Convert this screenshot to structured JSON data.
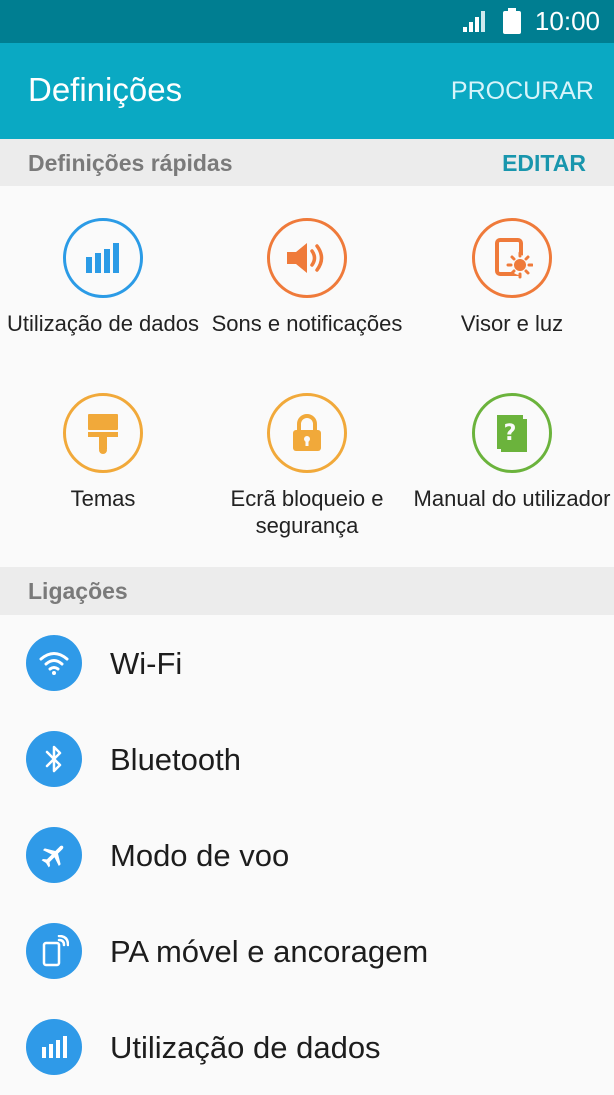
{
  "status_bar": {
    "time": "10:00",
    "icons": [
      "signal-icon",
      "battery-icon"
    ]
  },
  "app_bar": {
    "title": "Definições",
    "search_label": "PROCURAR"
  },
  "quick_settings": {
    "header": "Definições rápidas",
    "edit_label": "EDITAR",
    "tiles": [
      {
        "label": "Utilização de dados",
        "icon": "data-usage-icon",
        "color": "#2b9be6"
      },
      {
        "label": "Sons e notificações",
        "icon": "sound-icon",
        "color": "#ef7a3a"
      },
      {
        "label": "Visor e luz",
        "icon": "display-icon",
        "color": "#ef7a3a"
      },
      {
        "label": "Temas",
        "icon": "themes-icon",
        "color": "#f1a93a"
      },
      {
        "label": "Ecrã bloqueio e segurança",
        "icon": "lock-icon",
        "color": "#f1a93a"
      },
      {
        "label": "Manual do utilizador",
        "icon": "user-manual-icon",
        "color": "#6bb33c"
      }
    ]
  },
  "connections": {
    "header": "Ligações",
    "items": [
      {
        "label": "Wi-Fi",
        "icon": "wifi-icon"
      },
      {
        "label": "Bluetooth",
        "icon": "bluetooth-icon"
      },
      {
        "label": "Modo de voo",
        "icon": "airplane-icon"
      },
      {
        "label": "PA móvel e ancoragem",
        "icon": "hotspot-icon"
      },
      {
        "label": "Utilização de dados",
        "icon": "data-usage-icon"
      }
    ],
    "icon_color": "#2f9ae8"
  }
}
